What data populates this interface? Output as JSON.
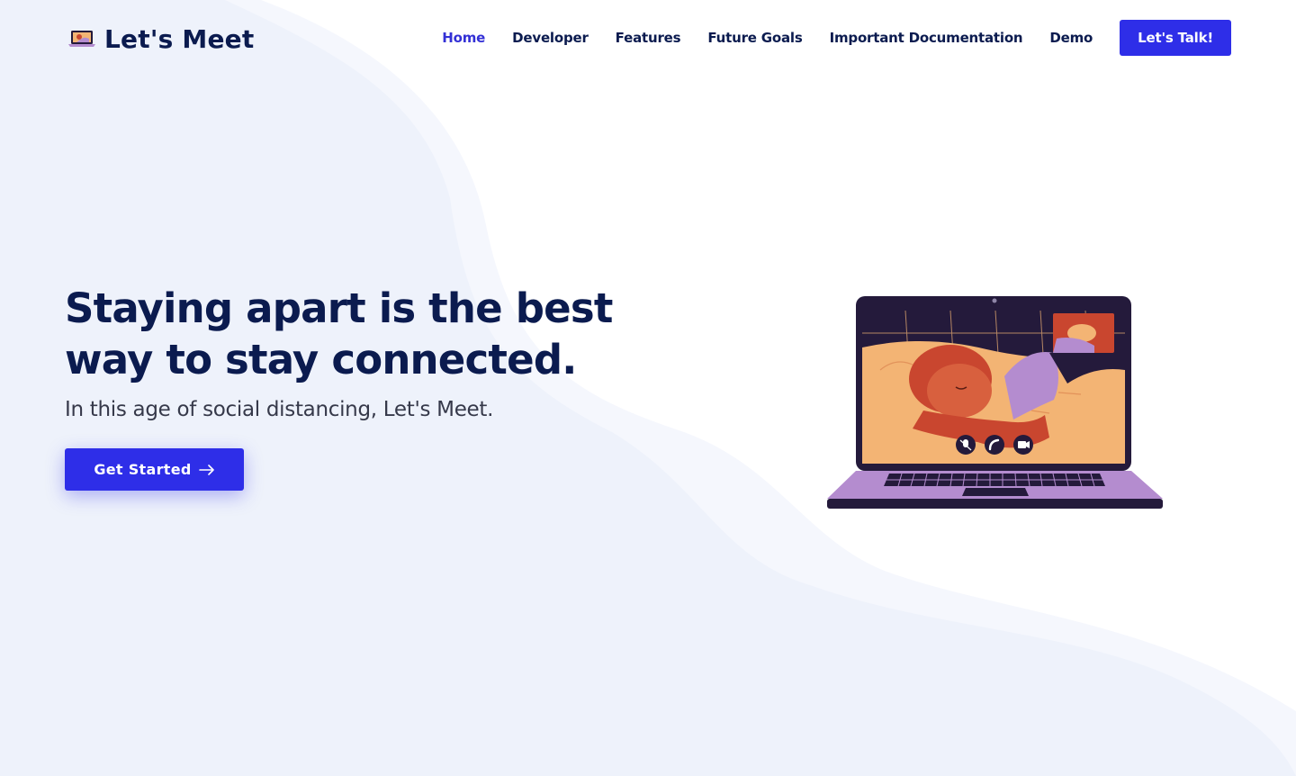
{
  "brand": {
    "name": "Let's Meet",
    "logo_icon": "laptop-video-call-icon"
  },
  "nav": {
    "items": [
      {
        "label": "Home",
        "active": true
      },
      {
        "label": "Developer",
        "active": false
      },
      {
        "label": "Features",
        "active": false
      },
      {
        "label": "Future Goals",
        "active": false
      },
      {
        "label": "Important Documentation",
        "active": false
      },
      {
        "label": "Demo",
        "active": false
      }
    ],
    "cta_label": "Let's Talk!"
  },
  "hero": {
    "title_line1": "Staying apart is the best",
    "title_line2": "way to stay connected.",
    "subtitle": "In this age of social distancing, Let's Meet.",
    "button_label": "Get Started",
    "button_icon": "arrow-right-icon"
  },
  "illustration": {
    "name": "laptop-video-call-illustration",
    "controls": [
      "mic-off-icon",
      "phone-icon",
      "video-camera-icon"
    ]
  },
  "colors": {
    "primary": "#2e2ee8",
    "active_link": "#3431d6",
    "heading": "#0b1b4f",
    "body_text": "#36394a",
    "wave_light": "#f5f7fd",
    "wave_mid": "#eef2fb"
  }
}
